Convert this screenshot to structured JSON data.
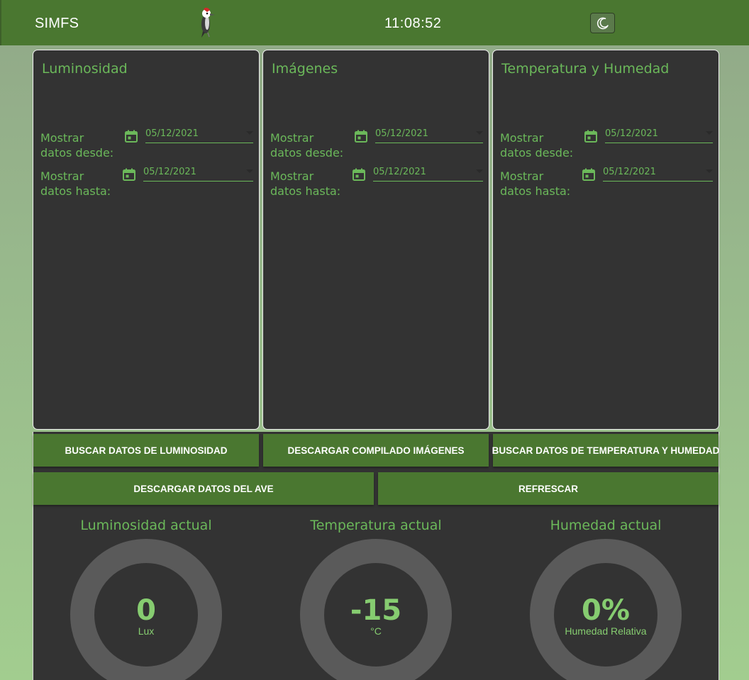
{
  "header": {
    "brand": "SIMFS",
    "clock": "11:08:52",
    "logo_icon": "woodpecker-icon",
    "theme_icon": "moon-icon"
  },
  "cards": [
    {
      "title": "Luminosidad",
      "from_label": "Mostrar datos desde:",
      "from_value": "05/12/2021",
      "to_label": "Mostrar datos hasta:",
      "to_value": "05/12/2021"
    },
    {
      "title": "Imágenes",
      "from_label": "Mostrar datos desde:",
      "from_value": "05/12/2021",
      "to_label": "Mostrar datos hasta:",
      "to_value": "05/12/2021"
    },
    {
      "title": "Temperatura y Humedad",
      "from_label": "Mostrar datos desde:",
      "from_value": "05/12/2021",
      "to_label": "Mostrar datos hasta:",
      "to_value": "05/12/2021"
    }
  ],
  "buttons": {
    "search_lux": "BUSCAR DATOS DE LUMINOSIDAD",
    "download_images": "DESCARGAR COMPILADO IMÁGENES",
    "search_temp_hum": "BUSCAR DATOS DE TEMPERATURA Y HUMEDAD",
    "download_bird": "DESCARGAR DATOS DEL AVE",
    "refresh": "REFRESCAR"
  },
  "gauges": [
    {
      "title": "Luminosidad actual",
      "value": "0",
      "unit": "Lux"
    },
    {
      "title": "Temperatura actual",
      "value": "-15",
      "unit": "°C"
    },
    {
      "title": "Humedad actual",
      "value": "0%",
      "unit": "Humedad Relativa"
    }
  ],
  "colors": {
    "accent": "#4a7730",
    "text_green": "#6bb85a",
    "card_bg": "#333333",
    "gauge_ring": "#5a5a5a"
  }
}
